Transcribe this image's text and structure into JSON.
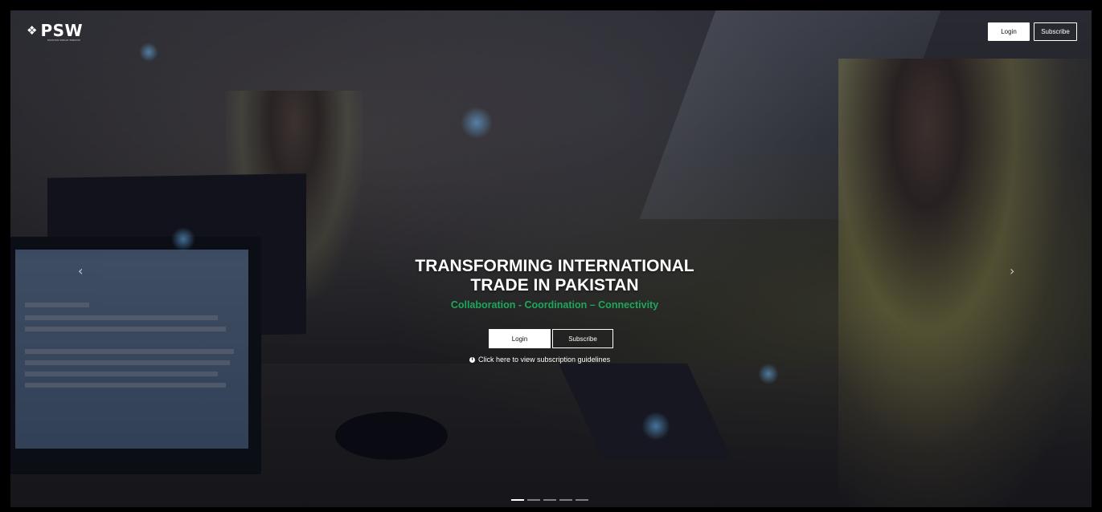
{
  "brand": {
    "logo_text": "PSW",
    "logo_tagline": "PAKISTAN SINGLE WINDOW"
  },
  "header": {
    "login_label": "Login",
    "subscribe_label": "Subscribe"
  },
  "hero": {
    "headline_line1": "TRANSFORMING INTERNATIONAL",
    "headline_line2": "TRADE IN PAKISTAN",
    "tagline": "Collaboration - Coordination – Connectivity",
    "login_label": "Login",
    "subscribe_label": "Subscribe",
    "guidelines_link": "Click here to view subscription guidelines",
    "prev_glyph": "‹",
    "next_glyph": "›",
    "slides_total": 5,
    "active_slide": 1
  },
  "colors": {
    "tagline": "#1ea75a",
    "button_bg": "#ffffff",
    "overlay": "#0a0e1c"
  },
  "icons": [
    "psw-logo-icon",
    "info-icon",
    "chevron-left-icon",
    "chevron-right-icon"
  ]
}
